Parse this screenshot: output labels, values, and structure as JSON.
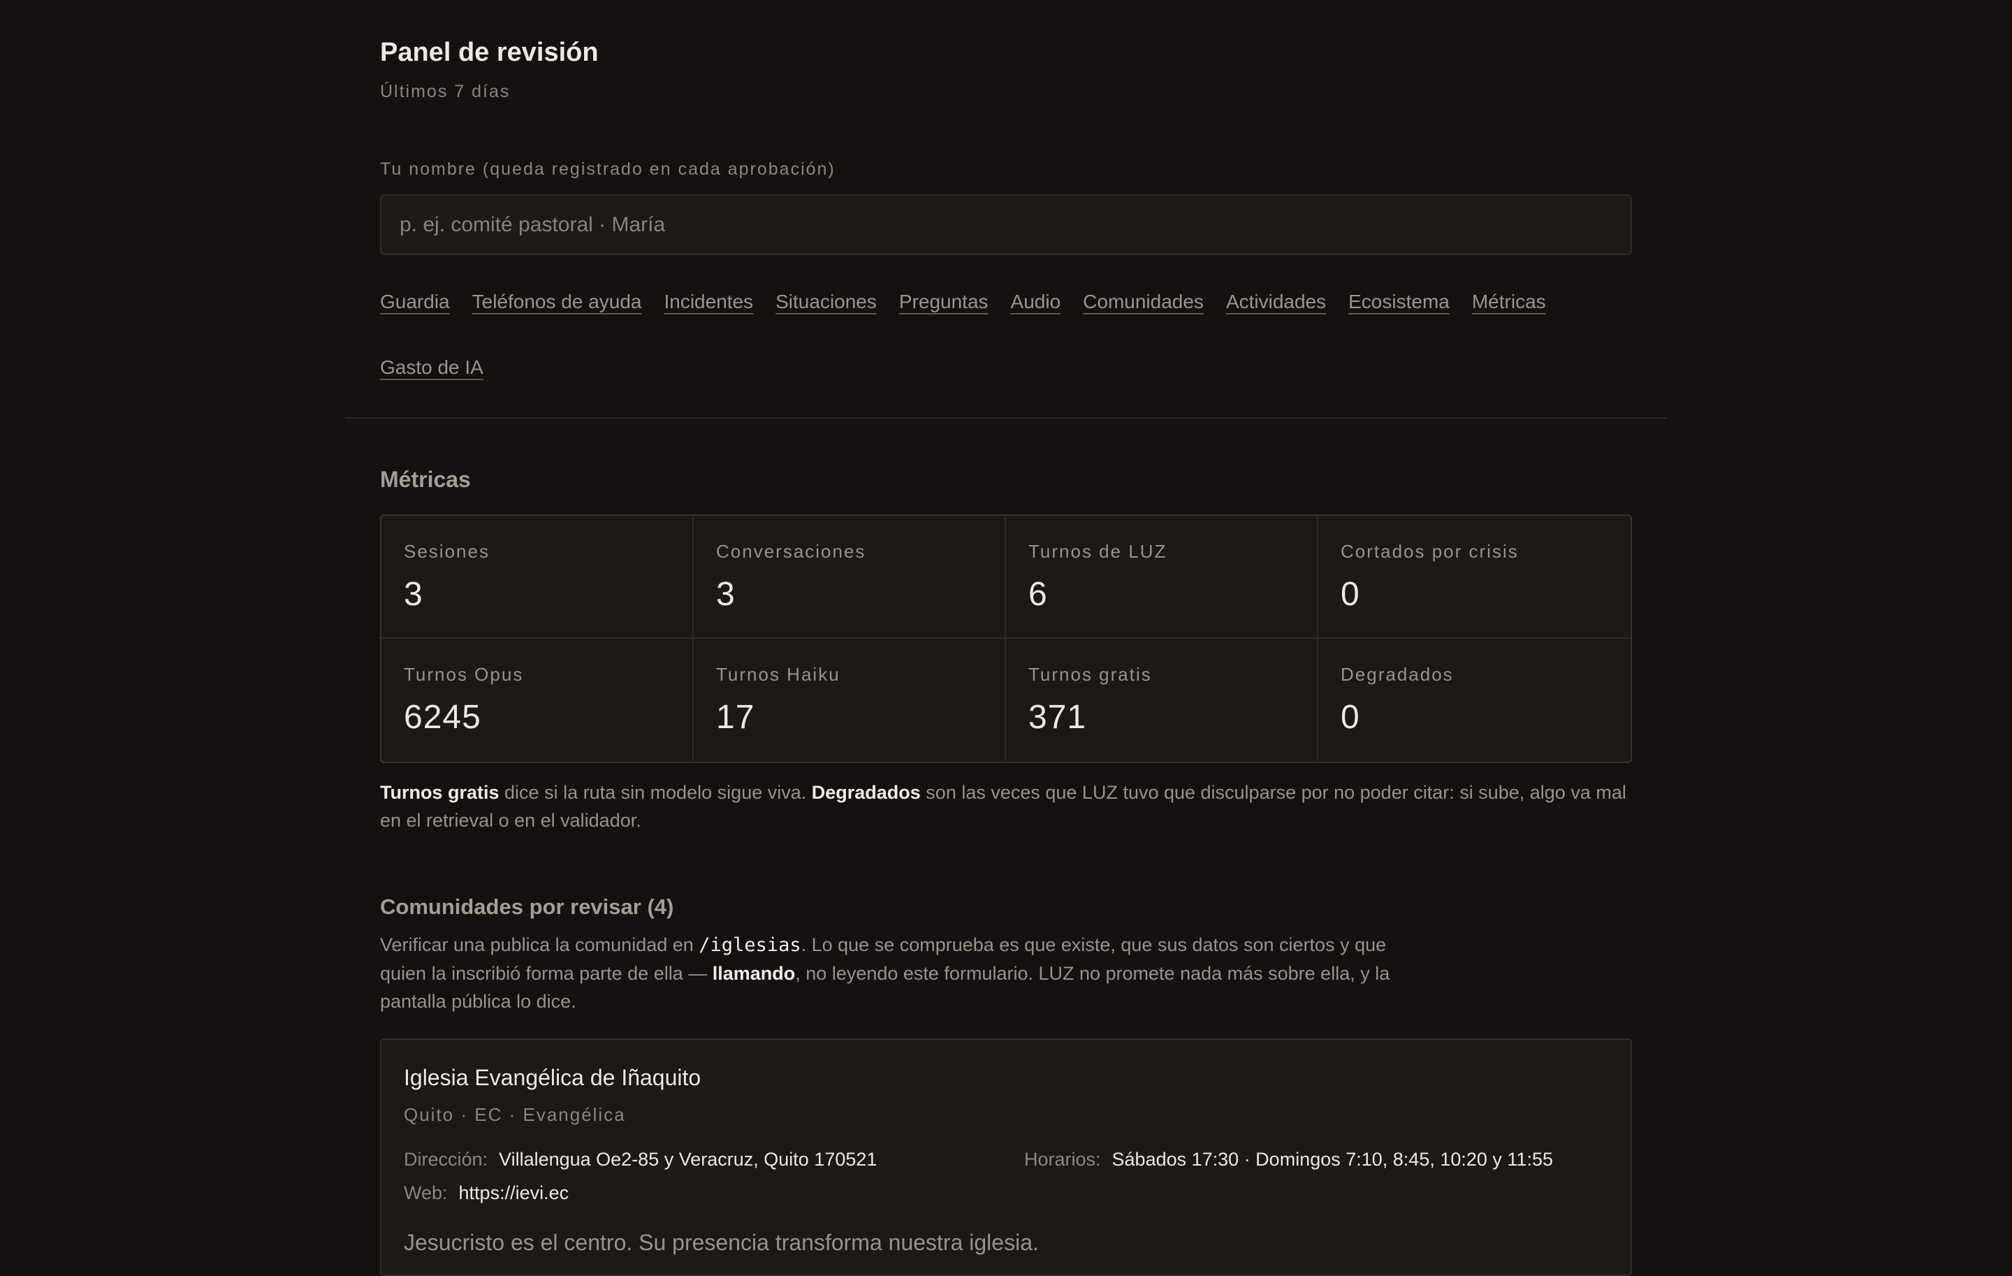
{
  "header": {
    "title": "Panel de revisión",
    "subtitle": "Últimos 7 días"
  },
  "name_field": {
    "label": "Tu nombre (queda registrado en cada aprobación)",
    "placeholder": "p. ej. comité pastoral · María",
    "value": ""
  },
  "nav": {
    "items": [
      "Guardia",
      "Teléfonos de ayuda",
      "Incidentes",
      "Situaciones",
      "Preguntas",
      "Audio",
      "Comunidades",
      "Actividades",
      "Ecosistema",
      "Métricas",
      "Gasto de IA"
    ]
  },
  "metrics": {
    "title": "Métricas",
    "cells": [
      {
        "label": "Sesiones",
        "value": "3"
      },
      {
        "label": "Conversaciones",
        "value": "3"
      },
      {
        "label": "Turnos de LUZ",
        "value": "6"
      },
      {
        "label": "Cortados por crisis",
        "value": "0"
      },
      {
        "label": "Turnos Opus",
        "value": "6245"
      },
      {
        "label": "Turnos Haiku",
        "value": "17"
      },
      {
        "label": "Turnos gratis",
        "value": "371"
      },
      {
        "label": "Degradados",
        "value": "0"
      }
    ],
    "note": {
      "b1": "Turnos gratis",
      "t1": " dice si la ruta sin modelo sigue viva. ",
      "b2": "Degradados",
      "t2": " son las veces que LUZ tuvo que disculparse por no poder citar: si sube, algo va mal en el retrieval o en el validador."
    }
  },
  "communities": {
    "title": "Comunidades por revisar (4)",
    "intro": {
      "t1": "Verificar una publica la comunidad en ",
      "code": "/iglesias",
      "t2": ". Lo que se comprueba es que existe, que sus datos son ciertos y que quien la inscribió forma parte de ella — ",
      "bold": "llamando",
      "t3": ", no leyendo este formulario. LUZ no promete nada más sobre ella, y la pantalla pública lo dice."
    },
    "card": {
      "name": "Iglesia Evangélica de Iñaquito",
      "meta": "Quito · EC · Evangélica",
      "address_label": "Dirección:",
      "address": "Villalengua Oe2-85 y Veracruz, Quito 170521",
      "hours_label": "Horarios:",
      "hours": "Sábados 17:30 · Domingos 7:10, 8:45, 10:20 y 11:55",
      "web_label": "Web:",
      "web": "https://ievi.ec",
      "description": "Jesucristo es el centro. Su presencia transforma nuestra iglesia."
    }
  }
}
